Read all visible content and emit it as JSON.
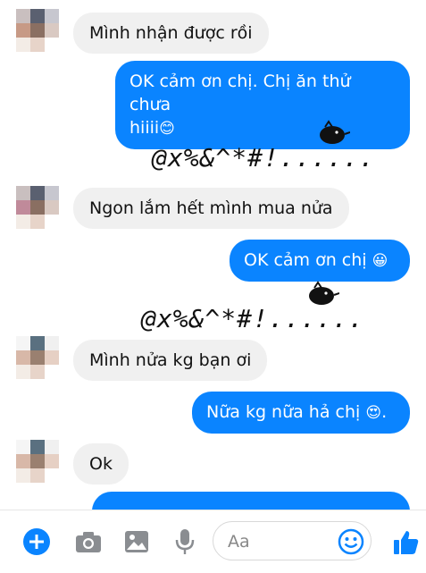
{
  "messages": {
    "m1": "Mình nhận được rồi",
    "m2_line1": "OK cảm ơn chị. Chị ăn thử chưa",
    "m2_line2": "hiiii",
    "m3": "Ngon lắm hết mình mua nửa",
    "m4": "OK cảm ơn chị",
    "m5": "Mình nửa kg bạn ơi",
    "m6": "Nữa kg nữa hả chị",
    "m7": "Ok"
  },
  "scribble": {
    "s1": "@x%&^*#!......",
    "s2": "@x%&^*#!......"
  },
  "composer": {
    "placeholder": "Aa"
  },
  "icons": {
    "add": "plus-circle-icon",
    "camera": "camera-icon",
    "gallery": "image-icon",
    "mic": "microphone-icon",
    "emoji": "smiley-icon",
    "like": "thumbs-up-icon"
  },
  "colors": {
    "accent": "#0a84ff",
    "incoming_bubble": "#f0f0f0"
  }
}
